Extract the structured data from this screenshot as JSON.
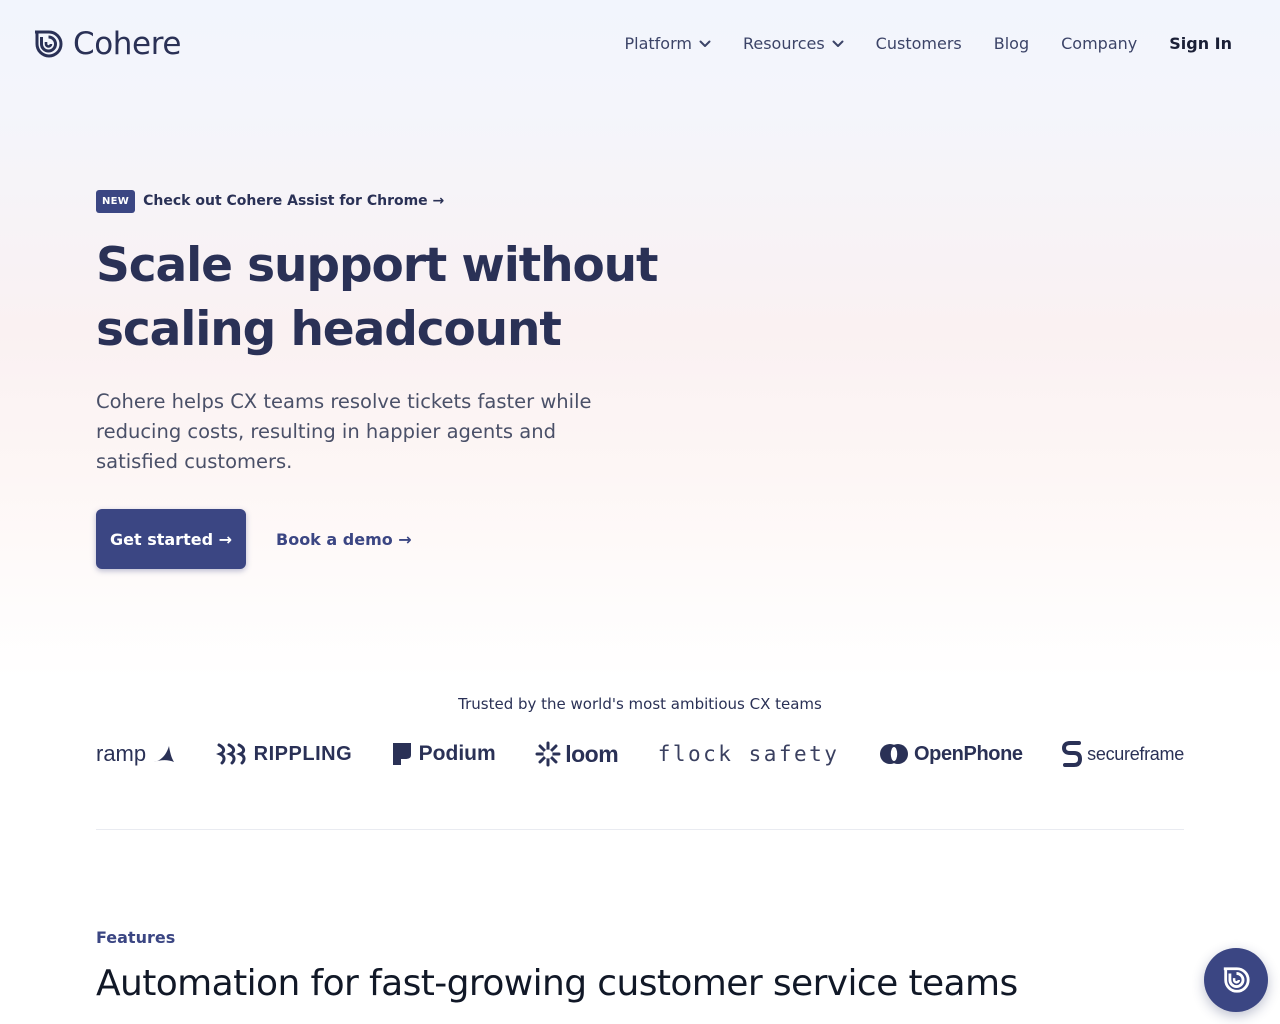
{
  "nav": {
    "logo_text": "Cohere",
    "items": [
      {
        "label": "Platform",
        "has_dropdown": true
      },
      {
        "label": "Resources",
        "has_dropdown": true
      },
      {
        "label": "Customers"
      },
      {
        "label": "Blog"
      },
      {
        "label": "Company"
      }
    ],
    "sign_in": "Sign In"
  },
  "hero": {
    "badge": "NEW",
    "announcement": "Check out Cohere Assist for Chrome →",
    "headline_line1": "Scale support without",
    "headline_line2": "scaling headcount",
    "subtext": "Cohere helps CX teams resolve tickets faster while reducing costs, resulting in happier agents and satisfied customers.",
    "primary_cta": "Get started →",
    "secondary_cta": "Book a demo →"
  },
  "trusted": {
    "heading": "Trusted by the world's most ambitious CX teams",
    "logos": [
      "ramp",
      "RIPPLING",
      "Podium",
      "loom",
      "flock safety",
      "OpenPhone",
      "secureframe"
    ]
  },
  "features": {
    "eyebrow": "Features",
    "title": "Automation for fast-growing customer service teams"
  },
  "colors": {
    "brand": "#3b4683",
    "heading": "#2a3156",
    "body_text": "#4a5068"
  },
  "icons": [
    "cohere-logo-icon",
    "chevron-down-icon",
    "ramp-logo-icon",
    "rippling-logo-icon",
    "podium-logo-icon",
    "loom-logo-icon",
    "openphone-logo-icon",
    "secureframe-logo-icon",
    "chat-widget-icon"
  ]
}
